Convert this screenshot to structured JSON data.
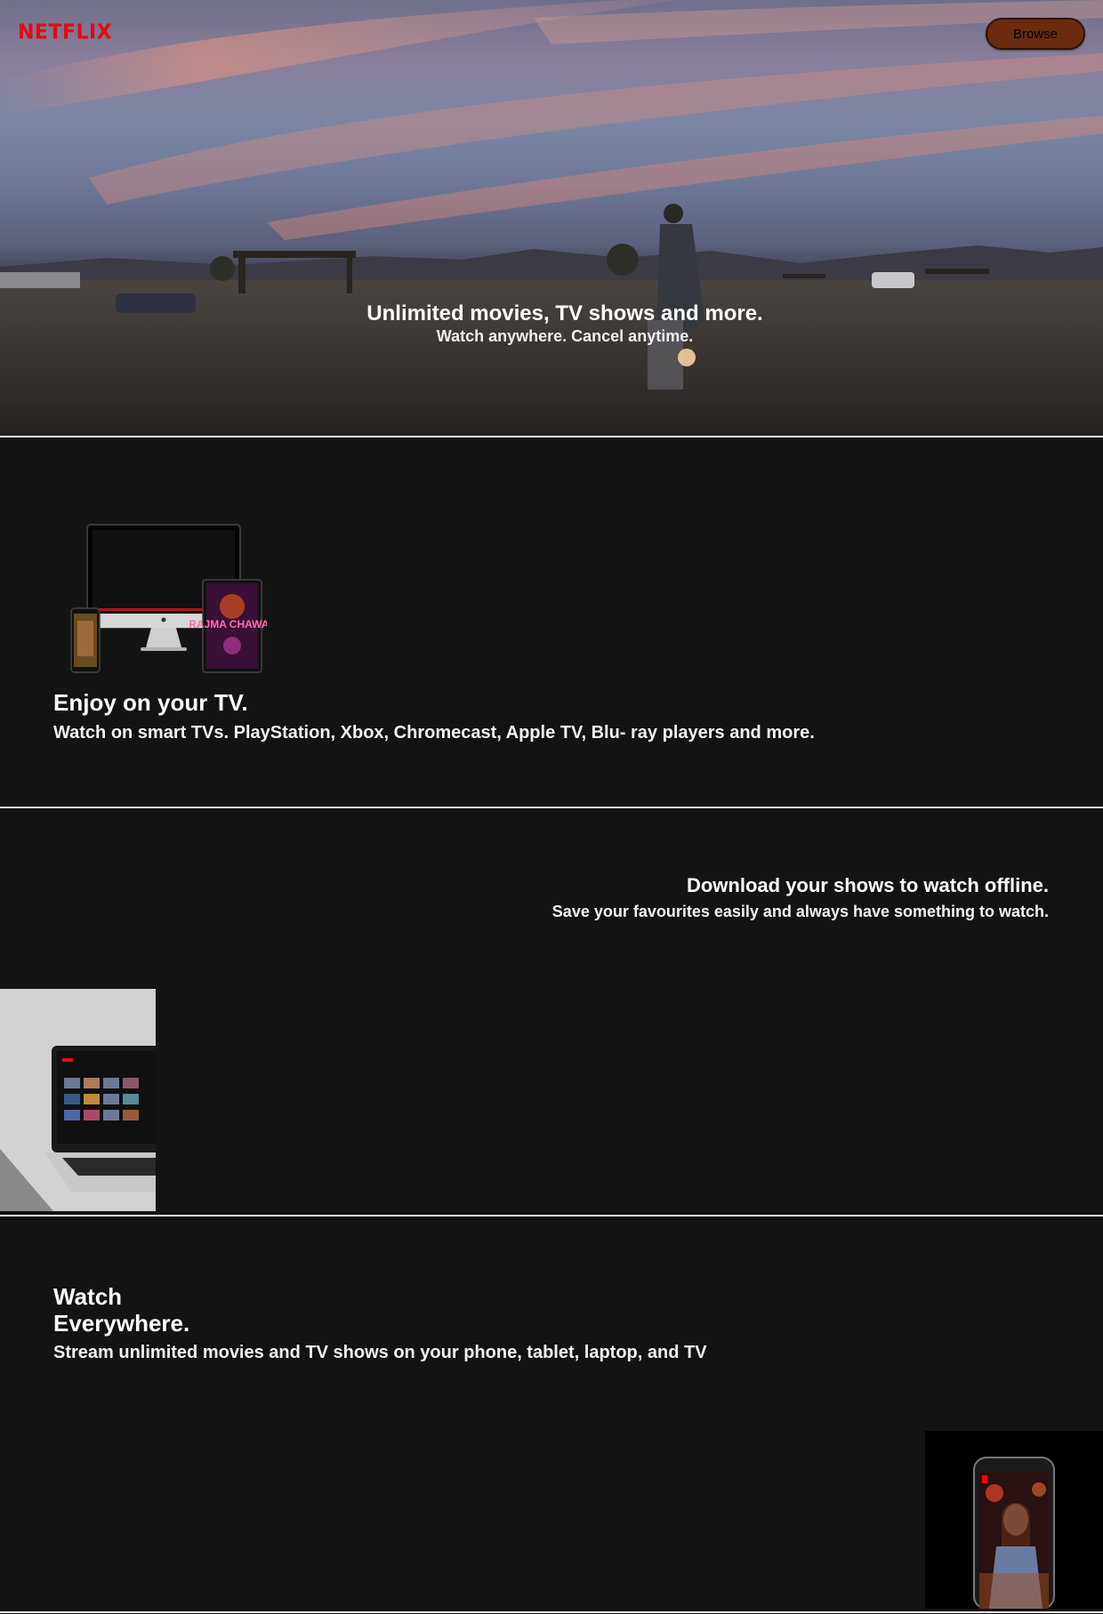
{
  "header": {
    "logo": "NETFLIX",
    "browse_label": "Browse"
  },
  "hero": {
    "title": "Unlimited movies, TV shows and more.",
    "subtitle": "Watch anywhere. Cancel anytime."
  },
  "sections": [
    {
      "title": "Enjoy on your TV.",
      "subtitle": "Watch on smart TVs. PlayStation, Xbox, Chromecast, Apple TV, Blu- ray players and more.",
      "image_alt": "devices-image"
    },
    {
      "title": "Download your shows to watch offline.",
      "subtitle": "Save your favourites easily and always have something to watch.",
      "image_alt": "laptop-image"
    },
    {
      "title_line1": "Watch",
      "title_line2": "Everywhere.",
      "subtitle": "Stream unlimited movies and TV shows on your phone, tablet, laptop, and TV",
      "image_alt": "phone-image"
    }
  ],
  "tablet_poster_text": "RAJMA CHAWAL",
  "colors": {
    "brand": "#e50914",
    "background": "#131313",
    "button": "#6a2b10"
  }
}
